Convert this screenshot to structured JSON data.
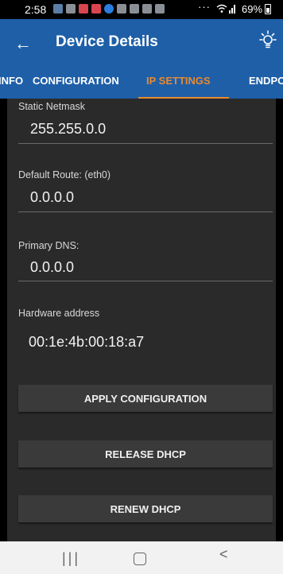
{
  "status_bar": {
    "time": "2:58",
    "overflow": "···",
    "signal": "≈.⨅",
    "battery": "69%"
  },
  "app_bar": {
    "back_icon": "arrow-left",
    "title": "Device Details",
    "light_icon": "lightbulb"
  },
  "tabs": [
    {
      "label": "INFO",
      "active": false
    },
    {
      "label": "CONFIGURATION",
      "active": false
    },
    {
      "label": "IP SETTINGS",
      "active": true
    },
    {
      "label": "ENDPOIN",
      "active": false
    }
  ],
  "fields": {
    "static_netmask": {
      "label": "Static Netmask",
      "value": "255.255.0.0"
    },
    "default_route": {
      "label": "Default Route: (eth0)",
      "value": "0.0.0.0"
    },
    "primary_dns": {
      "label": "Primary DNS:",
      "value": "0.0.0.0"
    },
    "hardware_address": {
      "label": "Hardware address",
      "value": "00:1e:4b:00:18:a7"
    }
  },
  "buttons": {
    "apply": "APPLY CONFIGURATION",
    "release": "RELEASE DHCP",
    "renew": "RENEW DHCP"
  },
  "nav_bar": {
    "recents": "|||",
    "back": "<"
  },
  "colors": {
    "app_bar": "#1e5fa8",
    "active_tab": "#e98a2e",
    "content_bg": "#2a2a2a"
  }
}
